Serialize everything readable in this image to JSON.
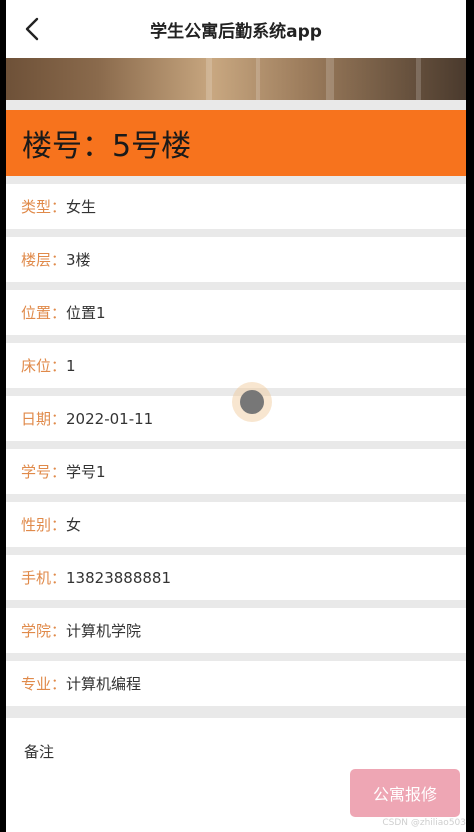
{
  "header": {
    "title": "学生公寓后勤系统app",
    "back_icon": "chevron-left-icon"
  },
  "headline": "楼号：5号楼",
  "fields": [
    {
      "label": "类型：",
      "value": "女生"
    },
    {
      "label": "楼层：",
      "value": "3楼"
    },
    {
      "label": "位置：",
      "value": "位置1"
    },
    {
      "label": "床位：",
      "value": "1"
    },
    {
      "label": "日期：",
      "value": "2022-01-11"
    },
    {
      "label": "学号：",
      "value": "学号1"
    },
    {
      "label": "性别：",
      "value": "女"
    },
    {
      "label": "手机：",
      "value": "13823888881"
    },
    {
      "label": "学院：",
      "value": "计算机学院"
    },
    {
      "label": "专业：",
      "value": "计算机编程"
    }
  ],
  "note_label": "备注",
  "repair_button": "公寓报修",
  "watermark": "CSDN @zhiliao503",
  "colors": {
    "accent_orange": "#f7731d",
    "label_color": "#e08a4a",
    "button_pink": "#eea6b4"
  }
}
